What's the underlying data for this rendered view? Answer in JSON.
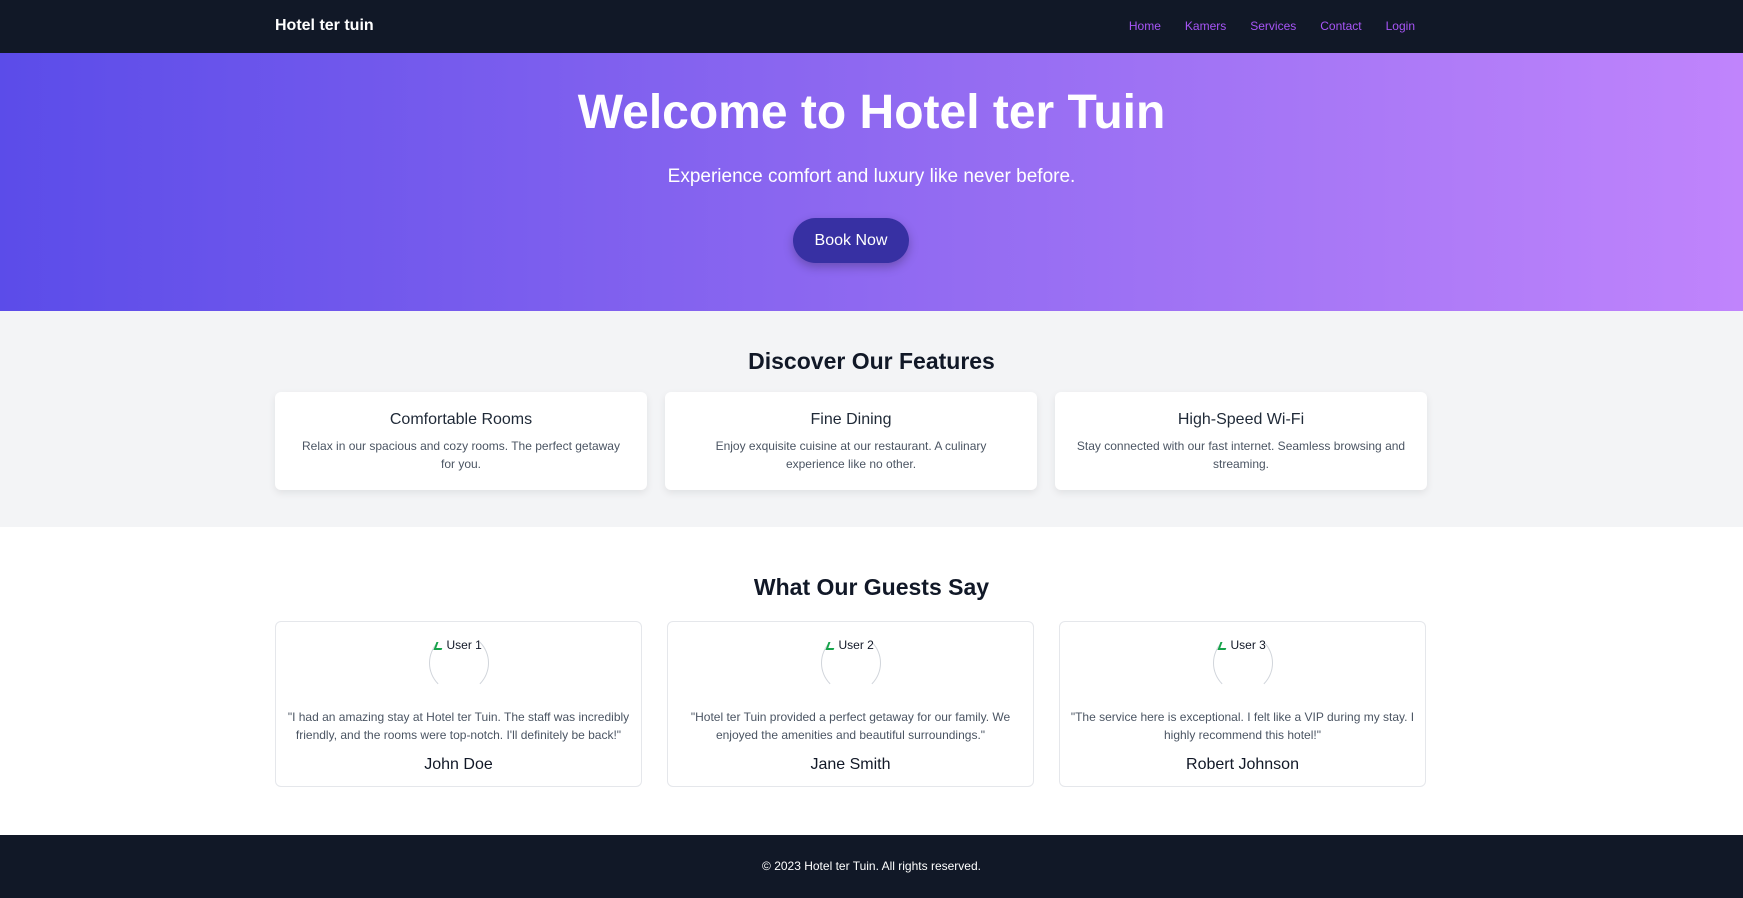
{
  "navbar": {
    "brand": "Hotel ter tuin",
    "links": [
      "Home",
      "Kamers",
      "Services",
      "Contact",
      "Login"
    ]
  },
  "hero": {
    "title": "Welcome to Hotel ter Tuin",
    "subtitle": "Experience comfort and luxury like never before.",
    "button": "Book Now"
  },
  "features": {
    "title": "Discover Our Features",
    "items": [
      {
        "title": "Comfortable Rooms",
        "text": "Relax in our spacious and cozy rooms. The perfect getaway for you."
      },
      {
        "title": "Fine Dining",
        "text": "Enjoy exquisite cuisine at our restaurant. A culinary experience like no other."
      },
      {
        "title": "High-Speed Wi-Fi",
        "text": "Stay connected with our fast internet. Seamless browsing and streaming."
      }
    ]
  },
  "testimonials": {
    "title": "What Our Guests Say",
    "items": [
      {
        "alt": "User 1",
        "quote": "\"I had an amazing stay at Hotel ter Tuin. The staff was incredibly friendly, and the rooms were top-notch. I'll definitely be back!\"",
        "name": "John Doe"
      },
      {
        "alt": "User 2",
        "quote": "\"Hotel ter Tuin provided a perfect getaway for our family. We enjoyed the amenities and beautiful surroundings.\"",
        "name": "Jane Smith"
      },
      {
        "alt": "User 3",
        "quote": "\"The service here is exceptional. I felt like a VIP during my stay. I highly recommend this hotel!\"",
        "name": "Robert Johnson"
      }
    ]
  },
  "footer": {
    "text": "© 2023 Hotel ter Tuin. All rights reserved."
  },
  "colors": {
    "nav_bg": "#111827",
    "nav_link": "#a855f7",
    "hero_start": "#5b4ce9",
    "hero_end": "#c084fc",
    "button": "#3730a3",
    "features_bg": "#f3f4f6"
  }
}
